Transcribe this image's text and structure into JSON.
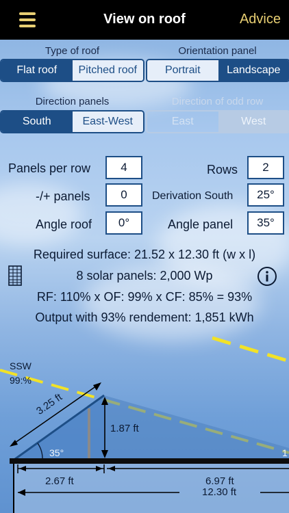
{
  "header": {
    "title": "View on roof",
    "advice_label": "Advice",
    "menu_icon": "hamburger-icon"
  },
  "type_of_roof": {
    "label": "Type of roof",
    "options": [
      "Flat roof",
      "Pitched roof"
    ],
    "selected": "Flat roof"
  },
  "orientation_panel": {
    "label": "Orientation panel",
    "options": [
      "Portrait",
      "Landscape"
    ],
    "selected": "Landscape"
  },
  "direction_panels": {
    "label": "Direction panels",
    "options": [
      "South",
      "East-West"
    ],
    "selected": "South"
  },
  "direction_odd_row": {
    "label": "Direction of odd row",
    "options": [
      "East",
      "West"
    ],
    "selected": "West",
    "enabled": false
  },
  "fields": {
    "panels_per_row": {
      "label": "Panels per row",
      "value": "4"
    },
    "rows": {
      "label": "Rows",
      "value": "2"
    },
    "plus_minus_panels": {
      "label": "-/+ panels",
      "value": "0"
    },
    "derivation_south": {
      "label": "Derivation South",
      "value": "25°"
    },
    "angle_roof": {
      "label": "Angle roof",
      "value": "0°"
    },
    "angle_panel": {
      "label": "Angle panel",
      "value": "35°"
    }
  },
  "results": {
    "required_surface": "Required surface: 21.52 x 12.30 ft (w x l)",
    "solar_panels": "8 solar panels: 2,000 Wp",
    "factors": "RF: 110% x OF: 99% x CF: 85% = 93%",
    "output": "Output with 93% rendement: 1,851 kWh"
  },
  "diagram": {
    "direction": "SSW",
    "direction_pct": "99:%",
    "panel_length": "3.25 ft",
    "panel_height": "1.87 ft",
    "panel_angle": "35°",
    "base_width": "2.67 ft",
    "gap_width": "6.97 ft",
    "total_length": "12.30 ft",
    "edge_marker": "1"
  },
  "colors": {
    "accent": "#e8cf73",
    "primary": "#1d4e86",
    "sun_line": "#f2e227"
  }
}
